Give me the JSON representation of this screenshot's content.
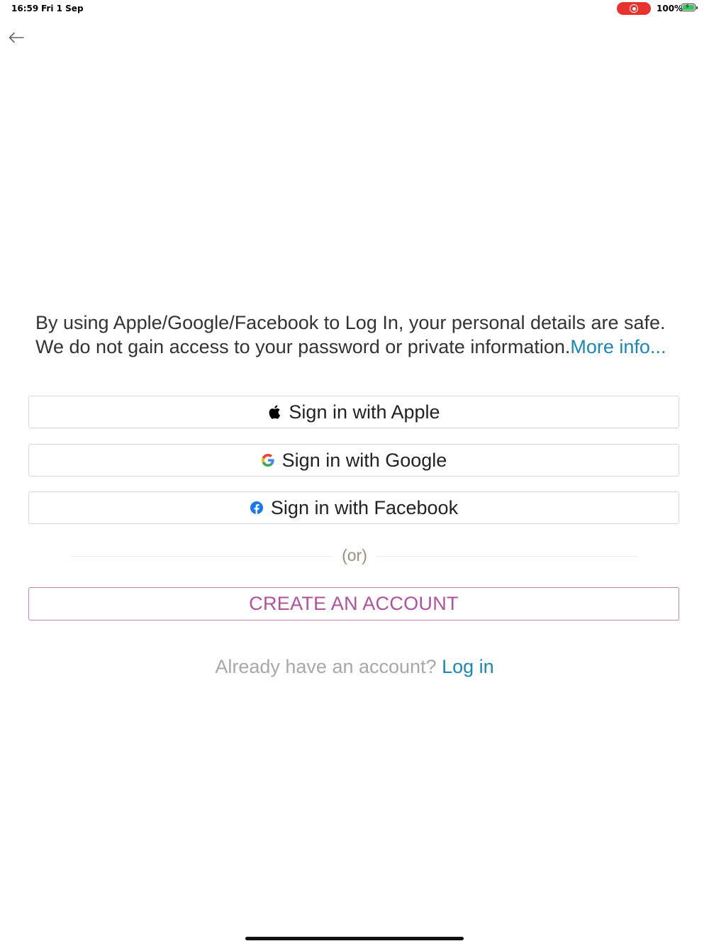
{
  "status_bar": {
    "time": "16:59",
    "date": "Fri 1 Sep",
    "battery_percent": "100%",
    "battery_level": 1.0,
    "recording_color": "#e8322d",
    "battery_color": "#34c759"
  },
  "nav": {
    "back_icon": "arrow-left-icon"
  },
  "info": {
    "text": "By using Apple/Google/Facebook to Log In, your personal details are safe. We do not gain access to your password or private information.",
    "more_link": "More info..."
  },
  "sso_buttons": {
    "apple": {
      "label": "Sign in with Apple",
      "icon": "apple-logo-icon"
    },
    "google": {
      "label": "Sign in with Google",
      "icon": "google-logo-icon"
    },
    "facebook": {
      "label": "Sign in with Facebook",
      "icon": "facebook-logo-icon"
    }
  },
  "divider": {
    "text": "(or)"
  },
  "create_account": {
    "label": "CREATE AN ACCOUNT",
    "color": "#b2519d"
  },
  "login": {
    "prompt": "Already have an account?",
    "link": "Log in",
    "link_color": "#1a87b8"
  }
}
